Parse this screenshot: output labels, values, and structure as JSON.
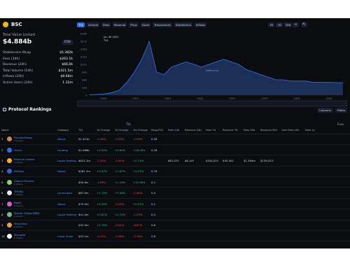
{
  "chain": {
    "name": "BSC",
    "logo_color": "#f0b90b"
  },
  "tvl": {
    "label": "Total Value Locked",
    "value": "$4.884b",
    "csv_label": "CSV"
  },
  "metrics": [
    {
      "k": "Stablecoins Mcap",
      "v": "$5.382b"
    },
    {
      "k": "Fees (24h)",
      "v": "$263.1k"
    },
    {
      "k": "Revenue (24h)",
      "v": "$66,0k"
    },
    {
      "k": "Total Volume (24h)",
      "v": "$321.5m"
    },
    {
      "k": "Inflows (24h)",
      "v": "$8.68m"
    },
    {
      "k": "Active Users (24h)",
      "v": "1.32m"
    }
  ],
  "toggles": [
    "TVL",
    "Volume",
    "Fees",
    "Revenue",
    "Price",
    "Users",
    "Transactions",
    "Stablecoins",
    "Inflows"
  ],
  "periods": [
    "1D",
    "7D",
    "30D"
  ],
  "chart_data": {
    "type": "area",
    "annotations": [
      "Jun 30 2022",
      "TVL"
    ],
    "watermark": "DefiLlama",
    "x_ticks": [
      "2020",
      "2021",
      "2021",
      "2022",
      "2022",
      "2023",
      "2023",
      "2024"
    ],
    "y_ticks": [
      "$24b",
      "$21b",
      "$18b",
      "$15b",
      "$12b",
      "$9b",
      "$6b",
      "$3b",
      "0"
    ],
    "series": [
      {
        "values": [
          0.2,
          0.3,
          0.5,
          1,
          2,
          5,
          9,
          14,
          21,
          9,
          8,
          11,
          12,
          13,
          12,
          11,
          12,
          13,
          14,
          13,
          12,
          10,
          9,
          8,
          7,
          6,
          6,
          5.5,
          5.5,
          5.5,
          5,
          5,
          5,
          4.9,
          4.9
        ]
      }
    ],
    "color": "#3b6fd8"
  },
  "rankings": {
    "title": "Protocol Rankings",
    "tools": [
      "Columns",
      "Filters"
    ],
    "group_label": "TVL",
    "group_label2": "Fees",
    "headers": [
      "Name",
      "Category",
      "TVL",
      "1d Change",
      "7d Change",
      "1m Change",
      "Mcap/TVL",
      "Fees 24h",
      "Revenue 24h",
      "Fees 7d",
      "Revenue 7d",
      "Fees 30d",
      "Revenue 30d",
      "User Fees 24h",
      "Fees 1y"
    ],
    "rows": [
      {
        "idx": "1",
        "name": "PancakeSwap",
        "sub": "3 chains",
        "logo": "#d1884f",
        "cat": "Dexes",
        "tvl": "$1.421b",
        "d1": "-0.26%",
        "d7": "-3.03%",
        "m1": "-2.93%",
        "mcap": "0.39",
        "f24": "",
        "r24": "",
        "f7": "",
        "r7": "",
        "f30": "",
        "r30": "",
        "uf": "",
        "f1y": ""
      },
      {
        "idx": "2",
        "name": "Venus",
        "sub": "",
        "logo": "#2f6fe4",
        "cat": "Lending",
        "tvl": "$1.069b",
        "d1": "+0.54%",
        "d7": "+2.89%",
        "m1": "+18.26%",
        "mcap": "0.16",
        "f24": "",
        "r24": "",
        "f7": "",
        "r7": "",
        "f30": "",
        "r30": "",
        "uf": "",
        "f1y": ""
      },
      {
        "idx": "3",
        "name": "Binance staked",
        "sub": "2 chains",
        "logo": "#f0b90b",
        "cat": "Liquid Staking",
        "tvl": "$621.1m",
        "d1": "-1.30%",
        "d7": "-1.91%",
        "m1": "+2.13%",
        "mcap": "",
        "f24": "$61,072",
        "r24": "$6,107",
        "f7": "$354,021",
        "r7": "$35,402",
        "f30": "$1.394m",
        "r30": "$139,412",
        "uf": "",
        "f1y": ""
      },
      {
        "idx": "4",
        "name": "BiSwap",
        "sub": "",
        "logo": "#3b5bd6",
        "cat": "Dexes",
        "tvl": "$281.1m",
        "d1": "+0.97%",
        "d7": "+1.67%",
        "m1": "+1.07%",
        "mcap": "0.79",
        "f24": "",
        "r24": "",
        "f7": "",
        "r7": "",
        "f30": "",
        "r30": "",
        "uf": "",
        "f1y": ""
      },
      {
        "idx": "5",
        "name": "Alpaca Finance",
        "sub": "3 chains",
        "logo": "#8fd16a",
        "cat": "",
        "tvl": "$90.6m",
        "d1": "-2.06%",
        "d7": "+1.18%",
        "m1": "+12.98%",
        "mcap": "0.2",
        "f24": "",
        "r24": "",
        "f7": "",
        "r7": "",
        "f30": "",
        "r30": "",
        "uf": "",
        "f1y": ""
      },
      {
        "idx": "6",
        "name": "THENA",
        "sub": "2 chains",
        "logo": "#e8e8e8",
        "cat": "Launchpad",
        "tvl": "$87.0m",
        "d1": "+1.74%",
        "d7": "+3.46%",
        "m1": "-1.40%",
        "mcap": "0.4",
        "f24": "",
        "r24": "",
        "f7": "",
        "r7": "",
        "f30": "",
        "r30": "",
        "uf": "",
        "f1y": ""
      },
      {
        "idx": "7",
        "name": "Beefy",
        "sub": "5 chains",
        "logo": "#d063c9",
        "cat": "Dexes",
        "tvl": "$75.2m",
        "d1": "+0.55%",
        "d7": "-0.25%",
        "m1": "+2.57%",
        "mcap": "0.1",
        "f24": "",
        "r24": "",
        "f7": "",
        "r7": "",
        "f30": "",
        "r30": "",
        "uf": "",
        "f1y": ""
      },
      {
        "idx": "8",
        "name": "Stader (Stake BNB)",
        "sub": "2 chains",
        "logo": "#63c38f",
        "cat": "Liquid Staking",
        "tvl": "$41.4m",
        "d1": "+0.81%",
        "d7": "+2.74%",
        "m1": "-1.53%",
        "mcap": "0.4",
        "f24": "",
        "r24": "",
        "f7": "",
        "r7": "",
        "f30": "",
        "r30": "",
        "uf": "",
        "f1y": ""
      },
      {
        "idx": "9",
        "name": "Tranchess",
        "sub": "2 chains",
        "logo": "#e5a23b",
        "cat": "",
        "tvl": "$32.5m",
        "d1": "+0.78%",
        "d7": "-0.01%",
        "m1": "-9.87%",
        "mcap": "0.8",
        "f24": "",
        "r24": "",
        "f7": "",
        "r7": "",
        "f30": "",
        "r30": "",
        "uf": "",
        "f1y": ""
      },
      {
        "idx": "10",
        "name": "Stargate",
        "sub": "8 chains",
        "logo": "#ffffff",
        "cat": "Cross Chain",
        "tvl": "$32.1m",
        "d1": "-0.15%",
        "d7": "-2.38%",
        "m1": "-3.78%",
        "mcap": "0.6",
        "f24": "",
        "r24": "",
        "f7": "",
        "r7": "",
        "f30": "",
        "r30": "",
        "uf": "",
        "f1y": ""
      }
    ]
  }
}
